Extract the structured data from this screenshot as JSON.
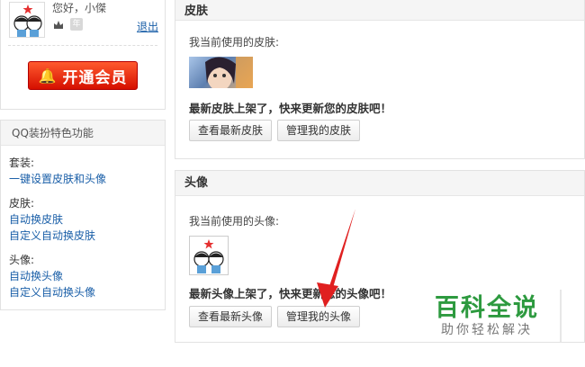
{
  "user": {
    "greeting": "您好，小傑",
    "logout": "退出",
    "vip_button": "开通会员"
  },
  "features": {
    "title": "QQ装扮特色功能",
    "groups": [
      {
        "label": "套装:",
        "links": [
          "一键设置皮肤和头像"
        ]
      },
      {
        "label": "皮肤:",
        "links": [
          "自动换皮肤",
          "自定义自动换皮肤"
        ]
      },
      {
        "label": "头像:",
        "links": [
          "自动换头像",
          "自定义自动换头像"
        ]
      }
    ]
  },
  "skin_panel": {
    "title": "皮肤",
    "current_label": "我当前使用的皮肤:",
    "promo": "最新皮肤上架了，快来更新您的皮肤吧！",
    "btn_latest": "查看最新皮肤",
    "btn_manage": "管理我的皮肤"
  },
  "avatar_panel": {
    "title": "头像",
    "current_label": "我当前使用的头像:",
    "promo": "最新头像上架了，快来更新您的头像吧！",
    "btn_latest": "查看最新头像",
    "btn_manage": "管理我的头像"
  },
  "watermark": {
    "logo": "百科全说",
    "sub": "助你轻松解决"
  },
  "colors": {
    "link": "#1a5fa8",
    "vip_red": "#e0260a",
    "arrow_red": "#e02020",
    "watermark_green": "#2d9a3f"
  },
  "icons": [
    "bell-icon",
    "avatar-cartoon-icon",
    "crown-level-icon",
    "year-badge-icon",
    "skin-thumbnail",
    "red-arrow-annotation"
  ]
}
